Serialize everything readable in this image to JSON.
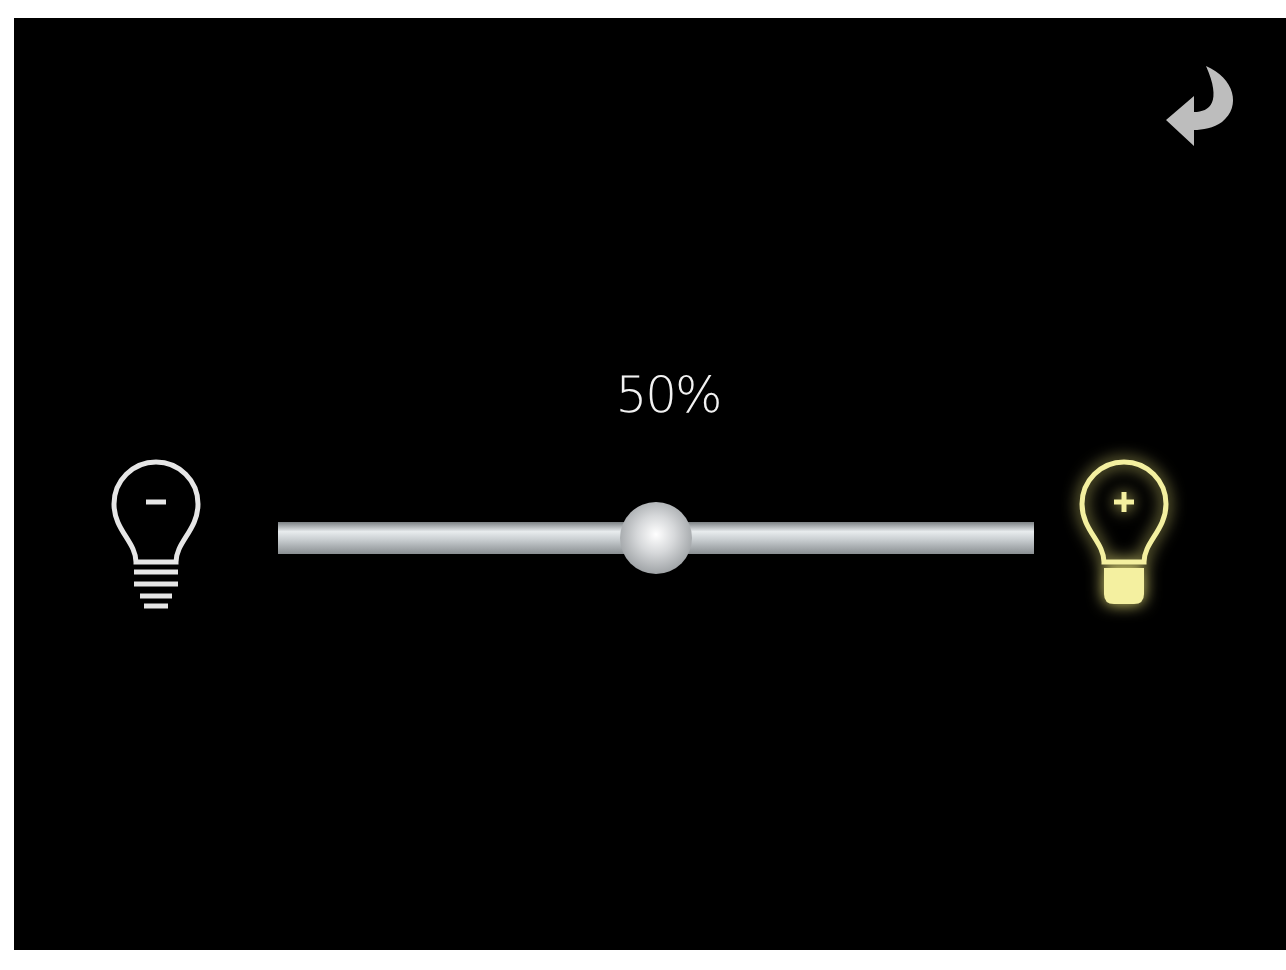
{
  "brightness": {
    "reading": "50%",
    "level": 0.5
  }
}
